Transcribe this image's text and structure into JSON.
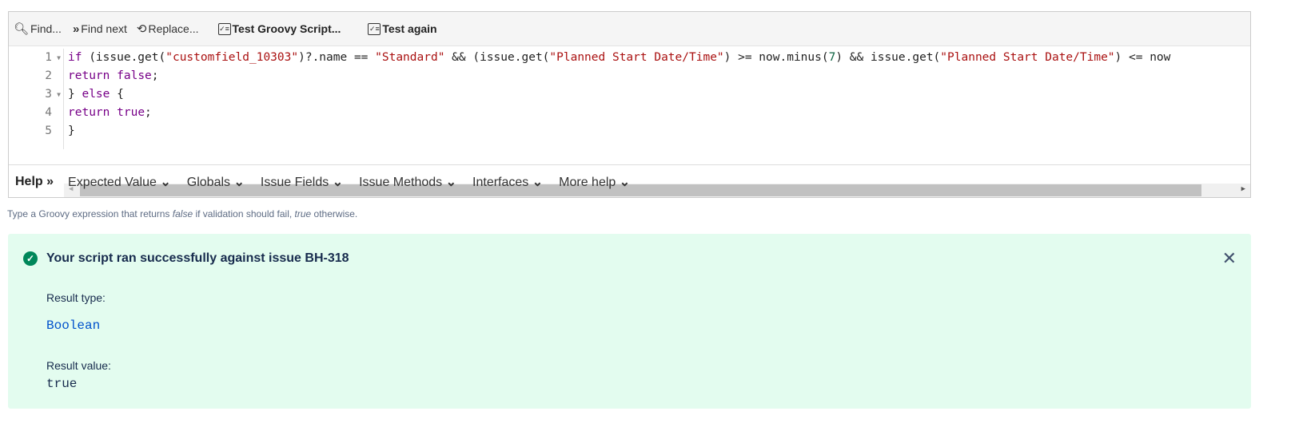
{
  "toolbar": {
    "find": "Find...",
    "find_next": "Find next",
    "replace": "Replace...",
    "test_script": "Test Groovy Script...",
    "test_again": "Test again"
  },
  "code": {
    "line_numbers": [
      "1",
      "2",
      "3",
      "4",
      "5"
    ],
    "lines": [
      [
        [
          "if",
          "kw"
        ],
        [
          " (issue.get(",
          ""
        ],
        [
          "\"customfield_10303\"",
          "str"
        ],
        [
          ")?.name == ",
          ""
        ],
        [
          "\"Standard\"",
          "str"
        ],
        [
          " && (issue.get(",
          ""
        ],
        [
          "\"Planned Start Date/Time\"",
          "str"
        ],
        [
          ") >= now.minus(",
          ""
        ],
        [
          "7",
          "num"
        ],
        [
          ") && issue.get(",
          ""
        ],
        [
          "\"Planned Start Date/Time\"",
          "str"
        ],
        [
          ") <= now",
          ""
        ]
      ],
      [
        [
          "return",
          "kw"
        ],
        [
          " ",
          ""
        ],
        [
          "false",
          "kw"
        ],
        [
          ";",
          ""
        ]
      ],
      [
        [
          "} ",
          ""
        ],
        [
          "else",
          "kw"
        ],
        [
          " {",
          ""
        ]
      ],
      [
        [
          "return",
          "kw"
        ],
        [
          " ",
          ""
        ],
        [
          "true",
          "kw"
        ],
        [
          ";",
          ""
        ]
      ],
      [
        [
          "}",
          ""
        ]
      ]
    ]
  },
  "help": {
    "title": "Help",
    "items": [
      "Expected Value",
      "Globals",
      "Issue Fields",
      "Issue Methods",
      "Interfaces",
      "More help"
    ]
  },
  "hint": {
    "prefix": "Type a Groovy expression that returns ",
    "false": "false",
    "middle": " if validation should fail, ",
    "true": "true",
    "suffix": " otherwise."
  },
  "result": {
    "title": "Your script ran successfully against issue BH-318",
    "type_label": "Result type:",
    "type_value": "Boolean",
    "value_label": "Result value:",
    "value": "true"
  }
}
